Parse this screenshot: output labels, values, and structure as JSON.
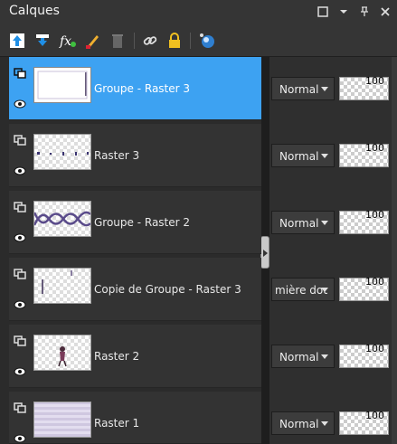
{
  "panel": {
    "title": "Calques"
  },
  "window_buttons": [
    {
      "name": "restore-icon"
    },
    {
      "name": "chevron-down-icon"
    },
    {
      "name": "pin-icon"
    },
    {
      "name": "close-icon"
    }
  ],
  "toolbar": [
    {
      "name": "new-layer-icon"
    },
    {
      "name": "merge-down-icon"
    },
    {
      "name": "layer-style-icon"
    },
    {
      "name": "edit-brush-icon"
    },
    {
      "name": "delete-layer-icon"
    },
    {
      "name": "link-icon"
    },
    {
      "name": "lock-icon"
    },
    {
      "name": "mask-icon"
    }
  ],
  "layers": [
    {
      "name": "Groupe - Raster 3",
      "blend": "Normal",
      "opacity": "100",
      "selected": true
    },
    {
      "name": "Raster 3",
      "blend": "Normal",
      "opacity": "100",
      "selected": false
    },
    {
      "name": "Groupe - Raster 2",
      "blend": "Normal",
      "opacity": "100",
      "selected": false
    },
    {
      "name": "Copie de Groupe - Raster 3",
      "blend": "mière dou",
      "opacity": "100",
      "selected": false
    },
    {
      "name": "Raster 2",
      "blend": "Normal",
      "opacity": "100",
      "selected": false
    },
    {
      "name": "Raster 1",
      "blend": "Normal",
      "opacity": "100",
      "selected": false
    }
  ],
  "colors": {
    "accent": "#3da2f2",
    "panel": "#2b2b2b",
    "toolbar": "#353535"
  }
}
